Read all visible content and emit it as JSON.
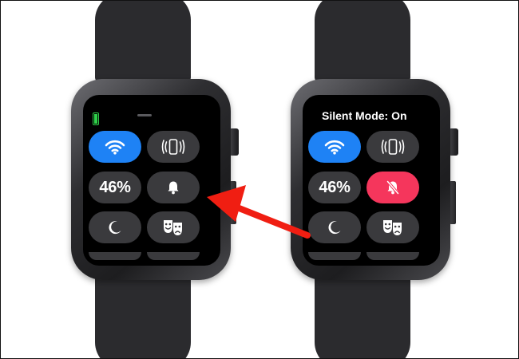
{
  "colors": {
    "wifi_active": "#1e82f5",
    "silent_active": "#f5365c",
    "tile_inactive": "#3a3a3d",
    "battery": "#2fd04a",
    "arrow": "#f01e12"
  },
  "watches": [
    {
      "name": "before",
      "status_text": "",
      "tiles": [
        {
          "id": "wifi",
          "icon": "wifi-icon",
          "active": true
        },
        {
          "id": "ping-iphone",
          "icon": "ping-iphone-icon",
          "active": false
        },
        {
          "id": "battery",
          "label": "46%",
          "active": false
        },
        {
          "id": "silent-mode",
          "icon": "bell-icon",
          "active": false
        },
        {
          "id": "do-not-disturb",
          "icon": "moon-icon",
          "active": false
        },
        {
          "id": "theater-mode",
          "icon": "theater-masks-icon",
          "active": false
        }
      ]
    },
    {
      "name": "after",
      "status_text": "Silent Mode: On",
      "tiles": [
        {
          "id": "wifi",
          "icon": "wifi-icon",
          "active": true
        },
        {
          "id": "ping-iphone",
          "icon": "ping-iphone-icon",
          "active": false
        },
        {
          "id": "battery",
          "label": "46%",
          "active": false
        },
        {
          "id": "silent-mode",
          "icon": "bell-slash-icon",
          "active": true
        },
        {
          "id": "do-not-disturb",
          "icon": "moon-icon",
          "active": false
        },
        {
          "id": "theater-mode",
          "icon": "theater-masks-icon",
          "active": false
        }
      ]
    }
  ],
  "annotation": {
    "icon": "arrow-icon",
    "points_to": "silent-mode tile of left watch"
  }
}
